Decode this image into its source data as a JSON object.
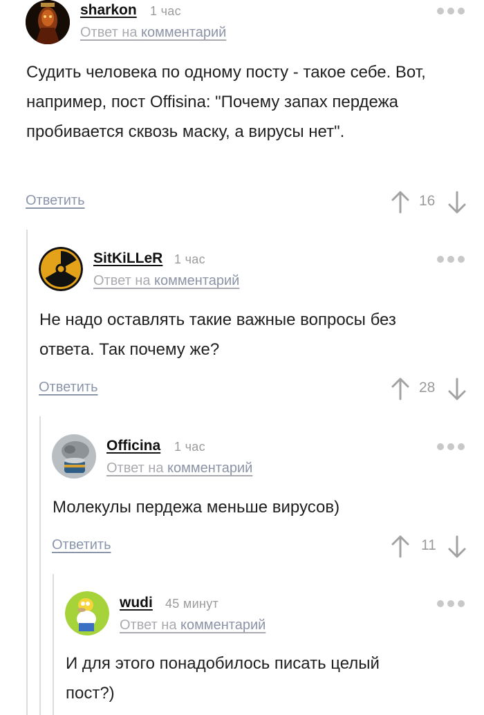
{
  "common": {
    "reply_prefix": "Ответ на",
    "reply_link": "комментарий",
    "reply_button": "Ответить"
  },
  "comments": [
    {
      "author": "sharkon",
      "time": "1 час",
      "text": "Судить человека по одному посту - такое себе. Вот, например, пост Offisina: \"Почему запах пердежа пробивается сквозь маску, а вирусы нет\".",
      "score": "16"
    },
    {
      "author": "SitKiLLeR",
      "time": "1 час",
      "text": "Не надо оставлять такие важные вопросы без ответа. Так почему же?",
      "score": "28"
    },
    {
      "author": "Officina",
      "time": "1 час",
      "text": "Молекулы пердежа меньше вирусов)",
      "score": "11"
    },
    {
      "author": "wudi",
      "time": "45 минут",
      "text": "И для этого понадобилось писать целый пост?)"
    }
  ]
}
